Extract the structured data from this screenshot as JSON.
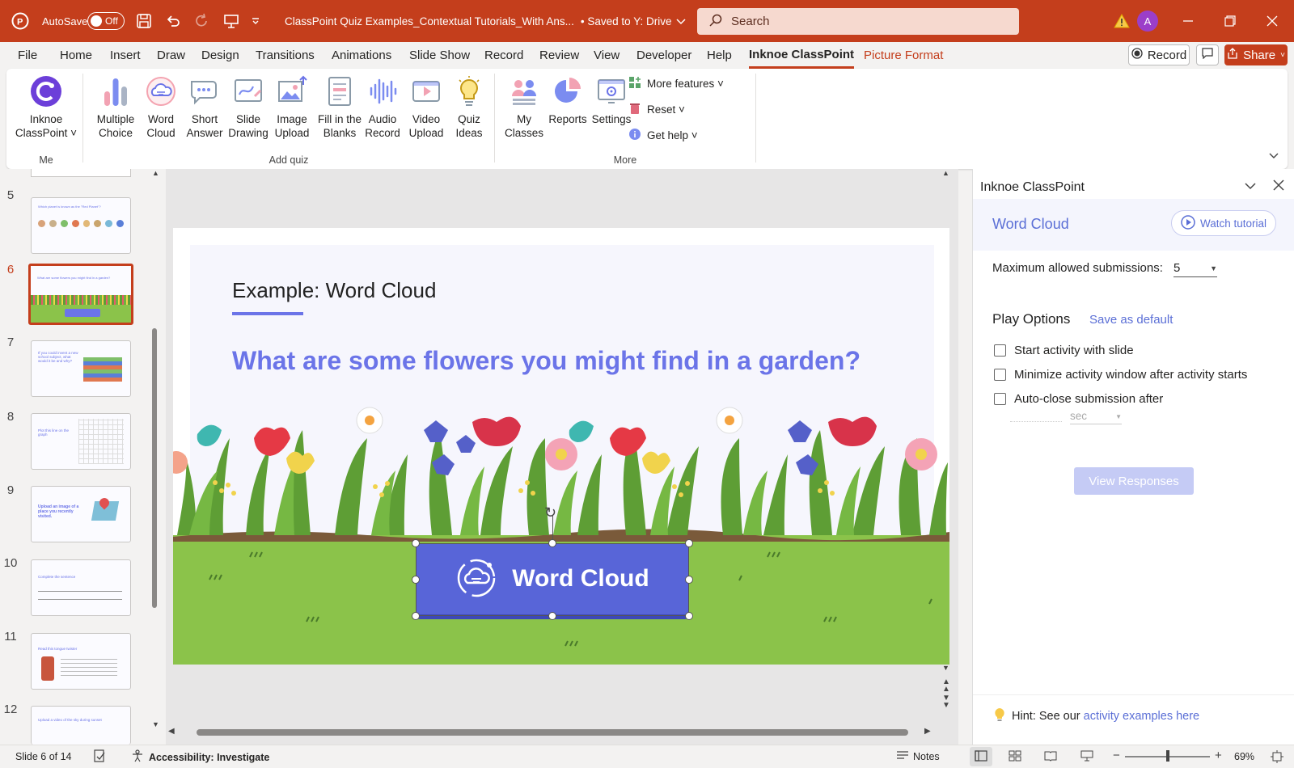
{
  "titlebar": {
    "app_icon": "powerpoint-icon",
    "autosave_label": "AutoSave",
    "autosave_state": "Off",
    "doc_title": "ClassPoint Quiz Examples_Contextual Tutorials_With Ans...",
    "saved_status": "• Saved to Y: Drive",
    "search_placeholder": "Search",
    "avatar_initial": "A"
  },
  "menu": {
    "items": [
      "File",
      "Home",
      "Insert",
      "Draw",
      "Design",
      "Transitions",
      "Animations",
      "Slide Show",
      "Record",
      "Review",
      "View",
      "Developer",
      "Help",
      "Inknoe ClassPoint",
      "Picture Format"
    ],
    "active": "Inknoe ClassPoint",
    "record_label": "Record",
    "share_label": "Share"
  },
  "ribbon": {
    "me_button": [
      "Inknoe",
      "ClassPoint ˅"
    ],
    "me_group": "Me",
    "quiz_buttons": [
      {
        "l1": "Multiple",
        "l2": "Choice"
      },
      {
        "l1": "Word",
        "l2": "Cloud"
      },
      {
        "l1": "Short",
        "l2": "Answer"
      },
      {
        "l1": "Slide",
        "l2": "Drawing"
      },
      {
        "l1": "Image",
        "l2": "Upload"
      },
      {
        "l1": "Fill in the",
        "l2": "Blanks"
      },
      {
        "l1": "Audio",
        "l2": "Record"
      },
      {
        "l1": "Video",
        "l2": "Upload"
      },
      {
        "l1": "Quiz",
        "l2": "Ideas"
      }
    ],
    "quiz_group": "Add quiz",
    "more_buttons": [
      {
        "l1": "My",
        "l2": "Classes"
      },
      {
        "l1": "Reports",
        "l2": ""
      },
      {
        "l1": "Settings",
        "l2": ""
      }
    ],
    "more_features": "More features ˅",
    "reset": "Reset ˅",
    "get_help": "Get help ˅",
    "more_group": "More"
  },
  "slides": {
    "numbers": [
      "5",
      "6",
      "7",
      "8",
      "9",
      "10",
      "11",
      "12"
    ],
    "selected": "6",
    "thumb_texts": [
      "Which planet is known as the \"Red Planet\"?",
      "What are some flowers you might find in a garden?",
      "If you could invent a new school subject, what would it be and why?",
      "Plot this line on the graph",
      "Upload an image of a place you recently visited.",
      "Complete the sentence",
      "Read this tongue twister",
      "Upload a video of the sky during sunset"
    ]
  },
  "slide": {
    "example_title": "Example: Word Cloud",
    "question": "What are some flowers you might find in a garden?",
    "button_label": "Word Cloud"
  },
  "panel": {
    "header": "Inknoe ClassPoint",
    "title": "Word Cloud",
    "watch_tutorial": "Watch tutorial",
    "max_submissions_label": "Maximum allowed submissions:",
    "max_submissions_value": "5",
    "play_options": "Play Options",
    "save_default": "Save as default",
    "options": [
      "Start activity with slide",
      "Minimize activity window after activity starts",
      "Auto-close submission after"
    ],
    "sec_label": "sec",
    "view_responses": "View Responses",
    "hint_prefix": "Hint: See our ",
    "hint_link": "activity examples here"
  },
  "status": {
    "slide_info": "Slide 6 of 14",
    "accessibility": "Accessibility: Investigate",
    "notes": "Notes",
    "zoom": "69%",
    "zoom_fraction": 0.5
  },
  "colors": {
    "brand": "#c43e1c",
    "accent": "#6b74e8",
    "grass": "#8bc34a",
    "panel_link": "#5b6fd6"
  }
}
